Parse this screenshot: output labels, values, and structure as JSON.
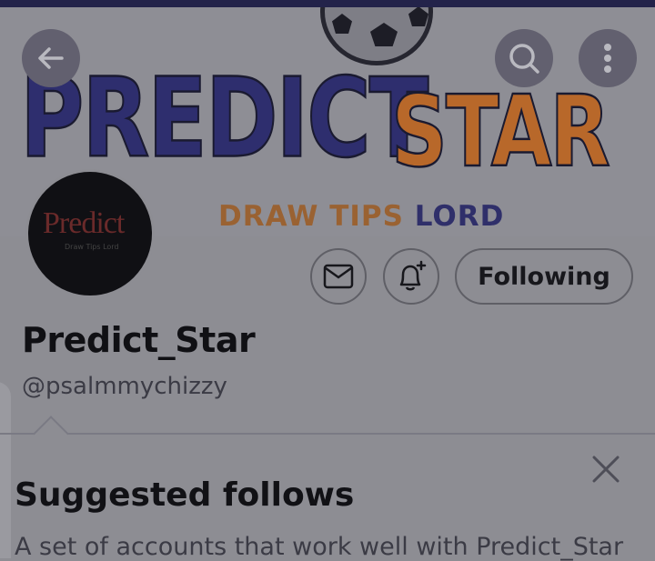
{
  "banner": {
    "brand_word_1": "PREDICT",
    "brand_word_2": "STAR",
    "tagline_part_1": "DRAW TIPS ",
    "tagline_part_2": "LORD"
  },
  "avatar": {
    "logo_text": "Predict",
    "logo_sub": "Draw Tips Lord"
  },
  "toolbar": {
    "back_icon": "arrow-left-icon",
    "search_icon": "search-icon",
    "more_icon": "more-vertical-icon"
  },
  "profile": {
    "display_name": "Predict_Star",
    "handle": "@psalmmychizzy",
    "following_label": "Following",
    "message_icon": "envelope-icon",
    "notify_icon": "bell-plus-icon"
  },
  "suggested": {
    "title": "Suggested follows",
    "description": "A set of accounts that work well with Predict_Star",
    "close_icon": "close-icon"
  },
  "colors": {
    "overlay_bg": "#8d8d93",
    "brand_blue": "#2e2e6e",
    "brand_orange": "#b8682a",
    "text_primary": "#101014"
  }
}
